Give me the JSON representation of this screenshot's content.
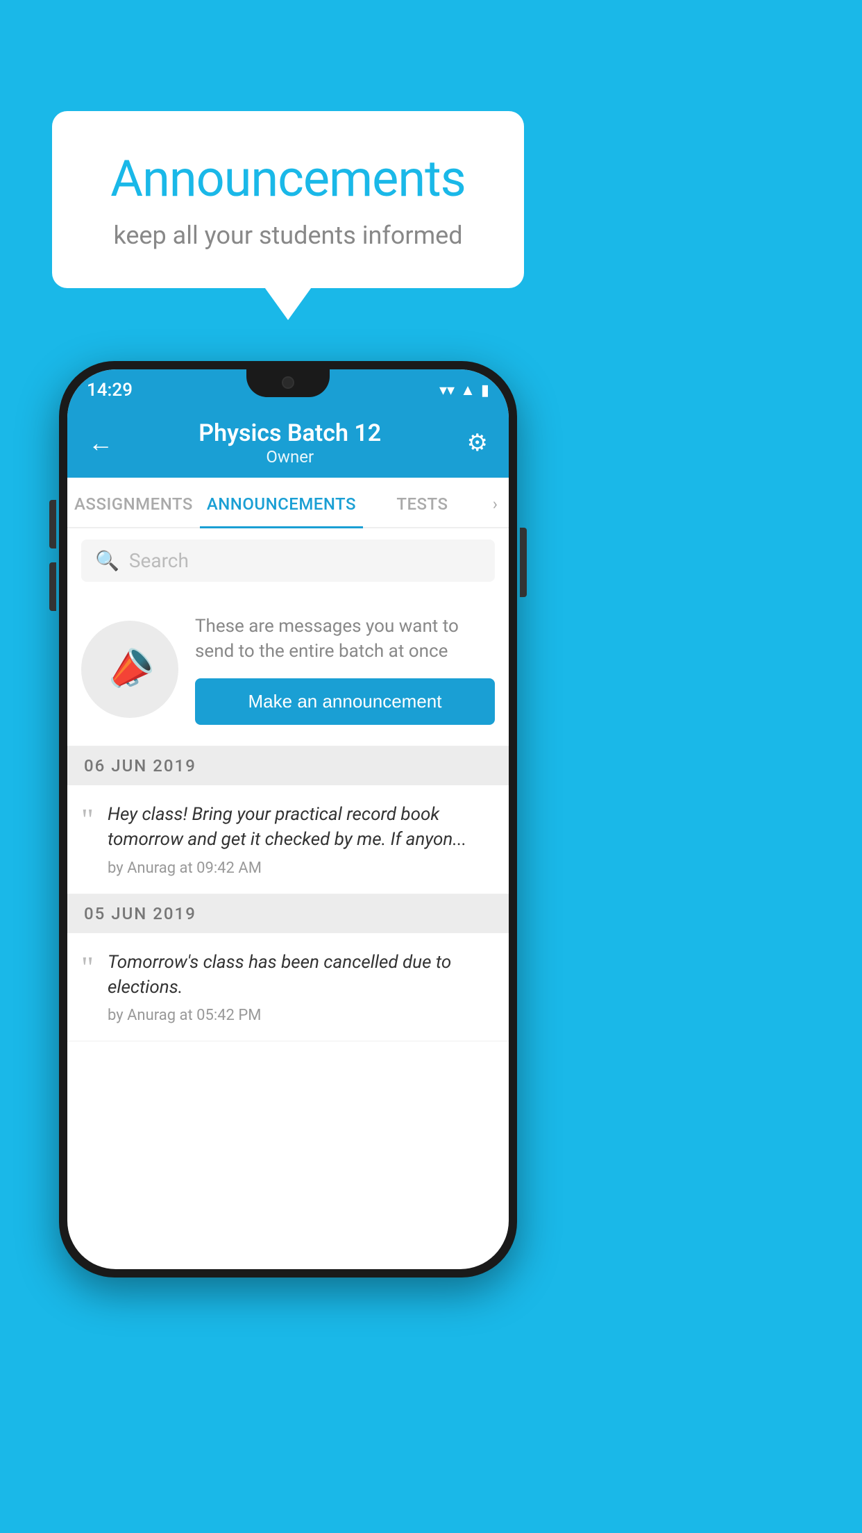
{
  "background_color": "#1ab8e8",
  "speech_bubble": {
    "title": "Announcements",
    "subtitle": "keep all your students informed"
  },
  "phone": {
    "status_bar": {
      "time": "14:29",
      "wifi": "▼",
      "signal": "▲",
      "battery": "▮"
    },
    "header": {
      "back_label": "←",
      "title": "Physics Batch 12",
      "subtitle": "Owner",
      "gear_label": "⚙"
    },
    "tabs": [
      {
        "label": "ASSIGNMENTS",
        "active": false
      },
      {
        "label": "ANNOUNCEMENTS",
        "active": true
      },
      {
        "label": "TESTS",
        "active": false
      }
    ],
    "tabs_more": "›",
    "search": {
      "placeholder": "Search"
    },
    "promo": {
      "description": "These are messages you want to send to the entire batch at once",
      "button_label": "Make an announcement"
    },
    "announcements": [
      {
        "date": "06  JUN  2019",
        "text": "Hey class! Bring your practical record book tomorrow and get it checked by me. If anyon...",
        "meta": "by Anurag at 09:42 AM"
      },
      {
        "date": "05  JUN  2019",
        "text": "Tomorrow's class has been cancelled due to elections.",
        "meta": "by Anurag at 05:42 PM"
      }
    ]
  }
}
